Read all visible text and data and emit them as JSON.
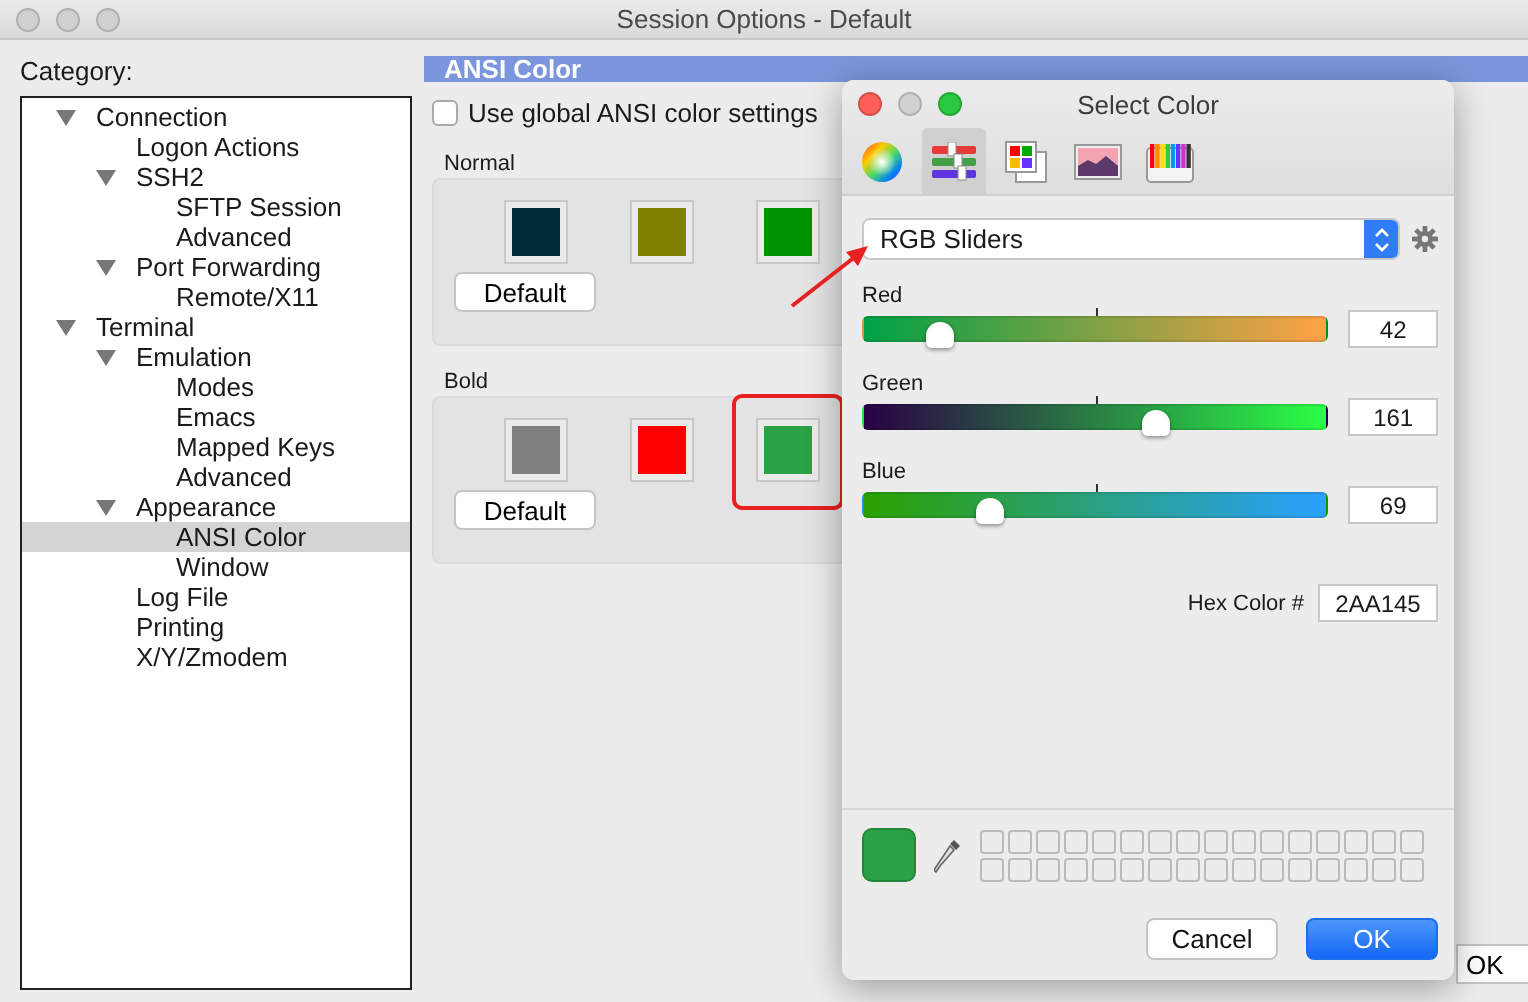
{
  "window": {
    "title": "Session Options - Default"
  },
  "category": {
    "label": "Category:",
    "tree": [
      {
        "label": "Connection",
        "expanded": true,
        "selected": false,
        "children": [
          {
            "label": "Logon Actions",
            "selected": false
          },
          {
            "label": "SSH2",
            "expanded": true,
            "selected": false,
            "children": [
              {
                "label": "SFTP Session",
                "selected": false
              },
              {
                "label": "Advanced",
                "selected": false
              }
            ]
          },
          {
            "label": "Port Forwarding",
            "expanded": true,
            "selected": false,
            "children": [
              {
                "label": "Remote/X11",
                "selected": false
              }
            ]
          }
        ]
      },
      {
        "label": "Terminal",
        "expanded": true,
        "selected": false,
        "children": [
          {
            "label": "Emulation",
            "expanded": true,
            "selected": false,
            "children": [
              {
                "label": "Modes",
                "selected": false
              },
              {
                "label": "Emacs",
                "selected": false
              },
              {
                "label": "Mapped Keys",
                "selected": false
              },
              {
                "label": "Advanced",
                "selected": false
              }
            ]
          },
          {
            "label": "Appearance",
            "expanded": true,
            "selected": false,
            "children": [
              {
                "label": "ANSI Color",
                "selected": true
              },
              {
                "label": "Window",
                "selected": false
              }
            ]
          },
          {
            "label": "Log File",
            "selected": false
          },
          {
            "label": "Printing",
            "selected": false
          },
          {
            "label": "X/Y/Zmodem",
            "selected": false
          }
        ]
      }
    ]
  },
  "panel": {
    "header": "ANSI Color",
    "use_global": {
      "label": "Use global ANSI color settings",
      "checked": false
    },
    "groups": [
      {
        "title": "Normal",
        "button": "Default",
        "swatches": [
          {
            "color": "#002b36",
            "highlighted": false
          },
          {
            "color": "#808000",
            "highlighted": false
          },
          {
            "color": "#009300",
            "highlighted": false
          }
        ]
      },
      {
        "title": "Bold",
        "button": "Default",
        "swatches": [
          {
            "color": "#808080",
            "highlighted": false
          },
          {
            "color": "#ff0000",
            "highlighted": false
          },
          {
            "color": "#2aa145",
            "highlighted": true
          }
        ]
      }
    ]
  },
  "ok_button": "OK",
  "color_dialog": {
    "title": "Select Color",
    "modes": [
      {
        "kind": "wheel",
        "selected": false
      },
      {
        "kind": "sliders",
        "selected": true
      },
      {
        "kind": "palettes",
        "selected": false
      },
      {
        "kind": "image",
        "selected": false
      },
      {
        "kind": "pencils",
        "selected": false
      }
    ],
    "mode_select": "RGB Sliders",
    "sliders": [
      {
        "kind": "red",
        "label": "Red",
        "level": 0.165,
        "value": "42"
      },
      {
        "kind": "green",
        "label": "Green",
        "level": 0.631,
        "value": "161"
      },
      {
        "kind": "blue",
        "label": "Blue",
        "level": 0.271,
        "value": "69"
      }
    ],
    "hex_label": "Hex Color #",
    "hex_value": "2AA145",
    "buttons": [
      {
        "label": "Cancel",
        "primary": false
      },
      {
        "label": "OK",
        "primary": true
      }
    ]
  }
}
